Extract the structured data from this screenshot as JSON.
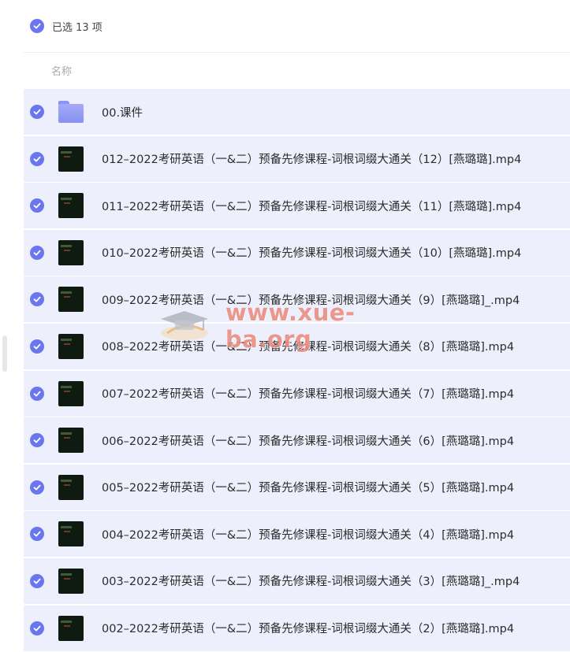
{
  "selection": {
    "label": "已选 13 项"
  },
  "columns": {
    "name": "名称"
  },
  "colors": {
    "accent": "#6a76ee",
    "row_selected_bg": "#edeffd"
  },
  "files": [
    {
      "name": "00.课件",
      "type": "folder",
      "icon": "folder-icon",
      "selected": true
    },
    {
      "name": "012–2022考研英语（一&二）预备先修课程-词根词缀大通关（12）[燕璐璐].mp4",
      "type": "video",
      "icon": "video-thumbnail",
      "selected": true
    },
    {
      "name": "011–2022考研英语（一&二）预备先修课程-词根词缀大通关（11）[燕璐璐].mp4",
      "type": "video",
      "icon": "video-thumbnail",
      "selected": true
    },
    {
      "name": "010–2022考研英语（一&二）预备先修课程-词根词缀大通关（10）[燕璐璐].mp4",
      "type": "video",
      "icon": "video-thumbnail",
      "selected": true
    },
    {
      "name": "009–2022考研英语（一&二）预备先修课程-词根词缀大通关（9）[燕璐璐]_.mp4",
      "type": "video",
      "icon": "video-thumbnail",
      "selected": true
    },
    {
      "name": "008–2022考研英语（一&二）预备先修课程-词根词缀大通关（8）[燕璐璐].mp4",
      "type": "video",
      "icon": "video-thumbnail",
      "selected": true
    },
    {
      "name": "007–2022考研英语（一&二）预备先修课程-词根词缀大通关（7）[燕璐璐].mp4",
      "type": "video",
      "icon": "video-thumbnail",
      "selected": true
    },
    {
      "name": "006–2022考研英语（一&二）预备先修课程-词根词缀大通关（6）[燕璐璐].mp4",
      "type": "video",
      "icon": "video-thumbnail",
      "selected": true
    },
    {
      "name": "005–2022考研英语（一&二）预备先修课程-词根词缀大通关（5）[燕璐璐].mp4",
      "type": "video",
      "icon": "video-thumbnail",
      "selected": true
    },
    {
      "name": "004–2022考研英语（一&二）预备先修课程-词根词缀大通关（4）[燕璐璐].mp4",
      "type": "video",
      "icon": "video-thumbnail",
      "selected": true
    },
    {
      "name": "003–2022考研英语（一&二）预备先修课程-词根词缀大通关（3）[燕璐璐]_.mp4",
      "type": "video",
      "icon": "video-thumbnail",
      "selected": true
    },
    {
      "name": "002–2022考研英语（一&二）预备先修课程-词根词缀大通关（2）[燕璐璐].mp4",
      "type": "video",
      "icon": "video-thumbnail",
      "selected": true
    }
  ],
  "watermark": {
    "text": "www.xue-ba.org"
  }
}
